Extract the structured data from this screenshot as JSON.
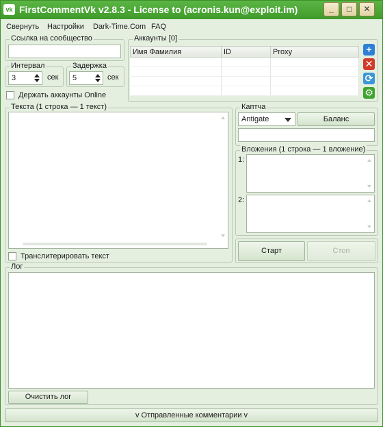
{
  "window": {
    "title": "FirstCommentVk v2.8.3 - License to (acronis.kun@exploit.im)",
    "logo_text": "vk",
    "minimize": "_",
    "maximize": "□",
    "close": "✕"
  },
  "menu": [
    "Свернуть",
    "Настройки",
    "Dark-Time.Com",
    "FAQ"
  ],
  "community": {
    "label": "Ссылка на сообщество",
    "value": ""
  },
  "interval": {
    "label": "Интервал",
    "value": "3",
    "unit": "сек"
  },
  "delay": {
    "label": "Задержка",
    "value": "5",
    "unit": "сек"
  },
  "keep_online": {
    "label": "Держать аккаунты Online",
    "checked": false
  },
  "accounts": {
    "label": "Аккаунты [0]",
    "columns": [
      "Имя Фамилия",
      "ID",
      "Proxy"
    ]
  },
  "side_icons": [
    "add-icon",
    "delete-icon",
    "refresh-icon",
    "settings-icon"
  ],
  "texts": {
    "label": "Текста (1 строка — 1 текст)",
    "value": ""
  },
  "transliterate": {
    "label": "Транслитерировать текст",
    "checked": false
  },
  "captcha": {
    "label": "Каптча",
    "selected": "Antigate",
    "balance_button": "Баланс",
    "key_value": ""
  },
  "attachments": {
    "label": "Вложения (1 строка — 1 вложение)",
    "slot1": "1:",
    "slot2": "2:"
  },
  "controls": {
    "start": "Старт",
    "stop": "Стоп"
  },
  "log": {
    "label": "Лог",
    "clear_button": "Очистить лог"
  },
  "footer": {
    "sent_comments": "v Отправленные комментарии v"
  },
  "colors": {
    "titlebar": "#4aa935",
    "window_bg": "#e4efe0"
  }
}
